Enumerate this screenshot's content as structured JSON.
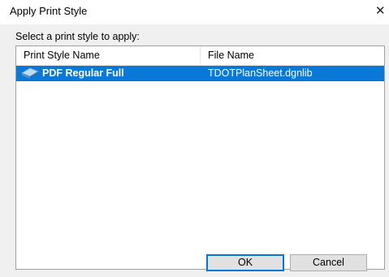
{
  "window": {
    "title": "Apply Print Style",
    "close_glyph": "✕"
  },
  "dialog": {
    "prompt": "Select a print style to apply:",
    "columns": [
      "Print Style Name",
      "File Name"
    ],
    "rows": [
      {
        "name": "PDF Regular Full",
        "file": "TDOTPlanSheet.dgnlib",
        "selected": true,
        "icon": "print-style-icon"
      }
    ],
    "selection_color": "#0a78d7"
  },
  "buttons": {
    "ok": "OK",
    "cancel": "Cancel"
  }
}
